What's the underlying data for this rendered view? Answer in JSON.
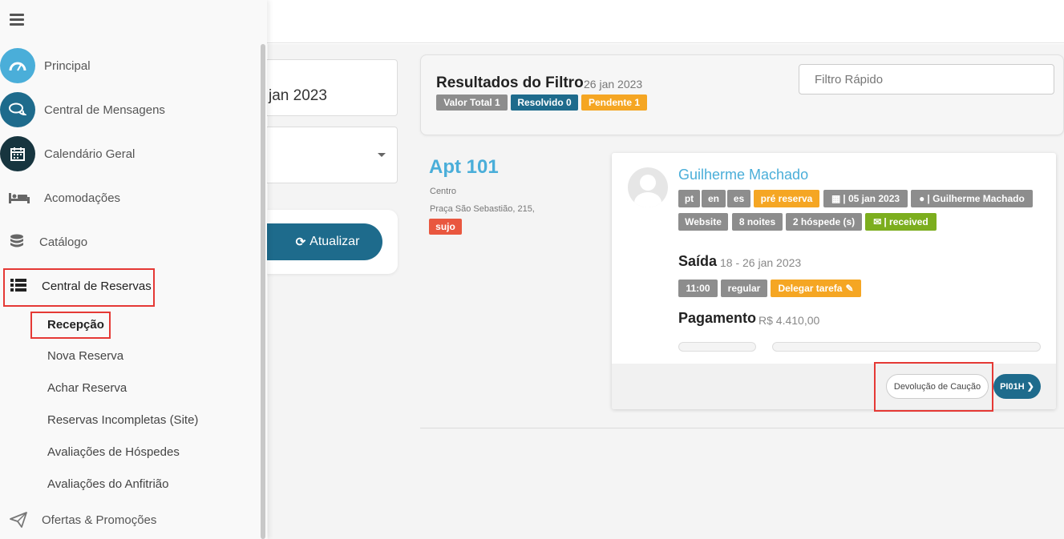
{
  "sidebar": {
    "menu": [
      {
        "label": "Principal",
        "icon": "speedometer-icon",
        "color": "#4aaed9"
      },
      {
        "label": "Central de Mensagens",
        "icon": "chat-bubbles-icon",
        "color": "#1e6b8c"
      },
      {
        "label": "Calendário Geral",
        "icon": "calendar-icon",
        "color": "#17353f"
      },
      {
        "label": "Acomodações",
        "icon": "bed-icon"
      },
      {
        "label": "Catálogo",
        "icon": "database-icon"
      },
      {
        "label": "Central de Reservas",
        "icon": "list-icon"
      },
      {
        "label": "Ofertas & Promoções",
        "icon": "paper-plane-icon"
      }
    ],
    "submenu": [
      {
        "label": "Recepção",
        "active": true
      },
      {
        "label": "Nova Reserva"
      },
      {
        "label": "Achar Reserva"
      },
      {
        "label": "Reservas Incompletas (Site)"
      },
      {
        "label": "Avaliações de Hóspedes"
      },
      {
        "label": "Avaliações do Anfitrião"
      }
    ]
  },
  "middle": {
    "date_fragment": "jan 2023",
    "update_label": "Atualizar"
  },
  "filter": {
    "title": "Resultados do Filtro",
    "date": "26 jan 2023",
    "badges": [
      "Valor Total 1",
      "Resolvido 0",
      "Pendente 1"
    ],
    "quick_placeholder": "Filtro Rápido"
  },
  "apartment": {
    "title": "Apt 101",
    "region": "Centro",
    "address": "Praça São Sebastião, 215,",
    "status": "sujo"
  },
  "booking": {
    "guest_name": "Guilherme Machado",
    "tags_row1": [
      "pt",
      "en",
      "es",
      "pré reserva",
      "| 05 jan 2023",
      "| Guilherme Machado"
    ],
    "tags_row2": [
      "Website",
      "8 noites",
      "2 hóspede (s)",
      "| received"
    ],
    "checkout": {
      "title": "Saída",
      "dates": "18 - 26 jan 2023",
      "tags": [
        "11:00",
        "regular",
        "Delegar tarefa"
      ]
    },
    "payment": {
      "title": "Pagamento",
      "amount": "R$ 4.410,00"
    },
    "refund_label": "Devolução de Caução",
    "pi_label": "PI01H"
  },
  "colors": {
    "accent_blue": "#1e6b8c",
    "light_blue": "#4aaed9",
    "orange": "#f5a623",
    "green": "#7cae1e",
    "red": "#e9573f",
    "highlight": "#e53935"
  }
}
